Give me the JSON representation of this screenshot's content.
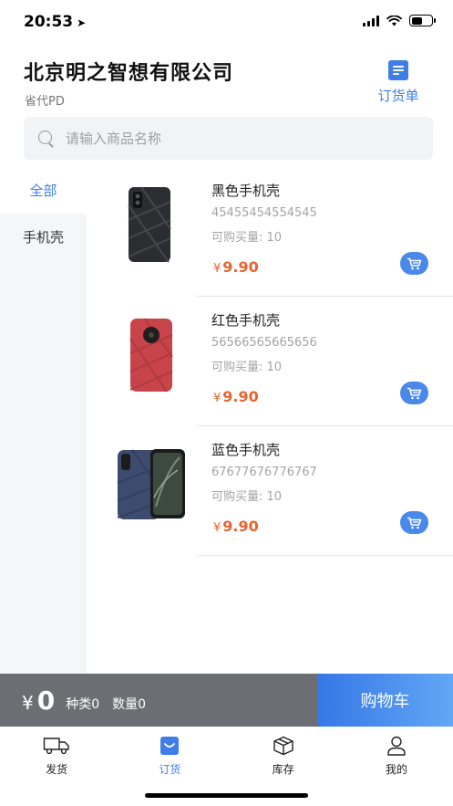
{
  "status_bar": {
    "time": "20:53",
    "location_arrow": "➤"
  },
  "header": {
    "company_name": "北京明之智想有限公司",
    "company_sub": "省代PD",
    "order_list_label": "订货单"
  },
  "search": {
    "placeholder": "请输入商品名称"
  },
  "categories": [
    {
      "label": "全部",
      "active": true
    },
    {
      "label": "手机壳",
      "active": false
    }
  ],
  "products": [
    {
      "name": "黑色手机壳",
      "code": "45455454554545",
      "stock": "可购买量: 10",
      "currency": "¥",
      "price": "9.90",
      "case_color": "#2b2d30"
    },
    {
      "name": "红色手机壳",
      "code": "56566565665656",
      "stock": "可购买量: 10",
      "currency": "¥",
      "price": "9.90",
      "case_color": "#c8444b"
    },
    {
      "name": "蓝色手机壳",
      "code": "67677676776767",
      "stock": "可购买量: 10",
      "currency": "¥",
      "price": "9.90",
      "case_color": "#3c4b6e"
    }
  ],
  "cart": {
    "currency": "¥",
    "total": "0",
    "kinds": "种类0",
    "quantity": "数量0",
    "go_label": "购物车"
  },
  "tabs": [
    {
      "label": "发货",
      "icon": "truck-icon"
    },
    {
      "label": "订货",
      "icon": "shopping-bag-icon",
      "active": true
    },
    {
      "label": "库存",
      "icon": "box-icon"
    },
    {
      "label": "我的",
      "icon": "user-icon"
    }
  ],
  "colors": {
    "accent": "#3f7ee8",
    "price": "#e8632f",
    "cart_bar": "#6d6e73"
  }
}
